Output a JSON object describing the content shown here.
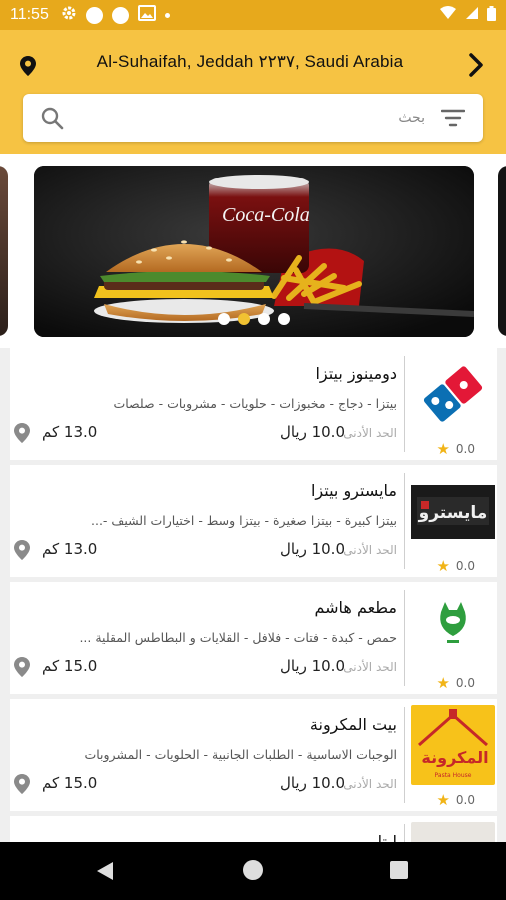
{
  "status_bar": {
    "time": "11:55"
  },
  "header": {
    "address": "Al-Suhaifah, Jeddah ٢٢٣٧, Saudi Arabia",
    "search_placeholder": "بحث",
    "accent_color": "#f6c343"
  },
  "carousel": {
    "slide_count": 4,
    "active_index": 1
  },
  "restaurants": [
    {
      "name": "دومينوز بيتزا",
      "description": "بيتزا - دجاج - مخبوزات - حلويات - مشروبات - صلصات",
      "min_label": "الحد الأدنى",
      "min_value": "10.0 ريال",
      "distance": "13.0 كم",
      "rating": "0.0",
      "logo": "dominos-logo"
    },
    {
      "name": "مايسترو بيتزا",
      "description": "بيتزا كبيرة - بيتزا صغيرة - بيتزا وسط - اختيارات الشيف -...",
      "min_label": "الحد الأدنى",
      "min_value": "10.0 ريال",
      "distance": "13.0 كم",
      "rating": "0.0",
      "logo": "maestro-logo"
    },
    {
      "name": "مطعم هاشم",
      "description": "حمص - كبدة - فتات - فلافل - القلايات و البطاطس المقلية ...",
      "min_label": "الحد الأدنى",
      "min_value": "10.0 ريال",
      "distance": "15.0 كم",
      "rating": "0.0",
      "logo": "hashem-logo"
    },
    {
      "name": "بيت المكرونة",
      "description": "الوجبات الاساسية - الطلبات الجانبية - الحلويات - المشروبات",
      "min_label": "الحد الأدنى",
      "min_value": "10.0 ريال",
      "distance": "15.0 كم",
      "rating": "0.0",
      "logo": "pasta-house-logo"
    },
    {
      "name": "ليتا",
      "logo": "partial-logo"
    }
  ]
}
